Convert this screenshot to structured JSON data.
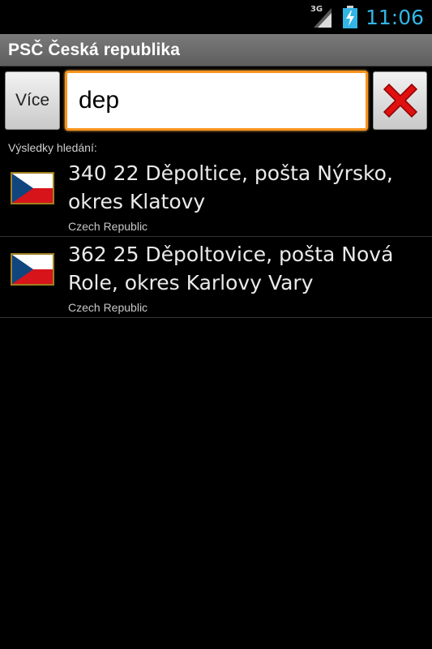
{
  "status_bar": {
    "network": "3G",
    "time": "11:06",
    "accent_color": "#33b5e5"
  },
  "app": {
    "title": "PSČ Česká republika"
  },
  "search": {
    "more_label": "Více",
    "value": "dep",
    "clear_icon": "red-x-icon",
    "focus_color": "#f7941d"
  },
  "results": {
    "label": "Výsledky hledání:",
    "items": [
      {
        "name": "340 22 Děpoltice, pošta Nýrsko, okres Klatovy",
        "country": "Czech Republic",
        "flag_icon": "czech-flag-icon"
      },
      {
        "name": "362 25 Děpoltovice, pošta Nová Role, okres Karlovy Vary",
        "country": "Czech Republic",
        "flag_icon": "czech-flag-icon"
      }
    ]
  }
}
